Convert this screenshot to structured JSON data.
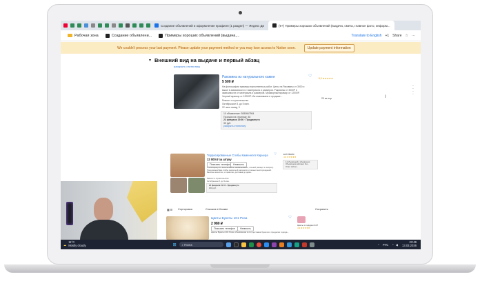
{
  "browser": {
    "tabs": [
      {
        "title": "Создание объявлений и оформление профиля (1 раздел) — Яндекс Диск",
        "active": false
      },
      {
        "title": "(9+) Примеры хороших объявлений (выдача, смета, главное фото, информ...",
        "active": true
      }
    ],
    "bookmarks": [
      {
        "label": "Рабочая зона"
      },
      {
        "label": "Создание объявлени..."
      },
      {
        "label": "Примеры хороших объявлений (выдача,..."
      }
    ],
    "translate_label": "Translate to English",
    "plus_count": "+1",
    "share_label": "Share"
  },
  "banner": {
    "message": "We couldn't process your last payment. Please update your payment method or you may lose access to Notion soon.",
    "button": "Update payment information"
  },
  "page": {
    "heading": "Внешний вид на выдаче и первый абзац",
    "heading_toggle": "▾",
    "sublink": "раскрыть статистику",
    "listing1": {
      "title": "Раковина из натурального камня",
      "price": "5 500 ₽",
      "rating": "5,0 ★★★★★",
      "description": "На фотографии примеры выполненных работ. Цены на Раковины от 3000 и выше в зависимости от материала и размеров. Раковины от 3000Р в зависимости от материала и размеров. Мраморный мрамор от 12000Р. Черный мрамор от 12000Р. Изготавливаем в продаже...",
      "repair": "Ремонт и строительство",
      "date": "Октябрьское 8. до 5 мин.",
      "views": "22 часа назад, 9",
      "stats": [
        "10 объявление: 3080667904",
        "Позиция на странице: 48",
        "23 февраля 19:50 · Продвинуто",
        "30 руб.",
        "раскрыть статистику"
      ],
      "side": "20 пе пор"
    },
    "listing2": {
      "title": "Террасированные Слэбы Каменного Карьера",
      "price": "12 000 ₽ за штуку",
      "btn_phone": "Показать телефон",
      "btn_write": "Написать",
      "description": "Слэб/Карьер 01 Эксклюзивное наименование, полный размер по запросу. Предлагаем Вам слябы различной расцветки и разных месторождений. Высокое качество, и гарантия, доставка до дома...",
      "repair": "Ремонт и строительство",
      "date": "Октябрьское 8. до 5 мин.",
      "stats": [
        "23 февраля 21:15 · Продвинуто",
        "150 руб."
      ],
      "side_name": "ЕКТИВНИК",
      "side_rating": "4,9 ★★★★★",
      "side_lines": [
        "14 объявлений в объявлении",
        "Объявления работают без...",
        "Ответ сейчас..."
      ]
    },
    "toolbar": {
      "sort": "Сортировка",
      "near": "Сначала в Москве",
      "save": "Сохранить"
    },
    "listing3": {
      "title": "Цветы Букеты 101 Роза",
      "price": "2 980 ₽",
      "btn_phone": "Показать телефон",
      "btn_write": "Написать",
      "description": "Цветы Букеты 101 Роза, объявление в сет доставка букетов в пределах города...",
      "side_name": "Цветы и подарки 24/7",
      "side_rating": "4,9 ★★★★★"
    }
  },
  "taskbar": {
    "weather_temp": "11°C",
    "weather_desc": "Mostly cloudy",
    "search": "Поиск",
    "lang": "РУС",
    "time": "23:49",
    "date": "13.03.2026"
  },
  "colors": {
    "banner_bg": "#fbecc4",
    "link": "#2f7ad9",
    "taskbar": "#1d2333"
  }
}
